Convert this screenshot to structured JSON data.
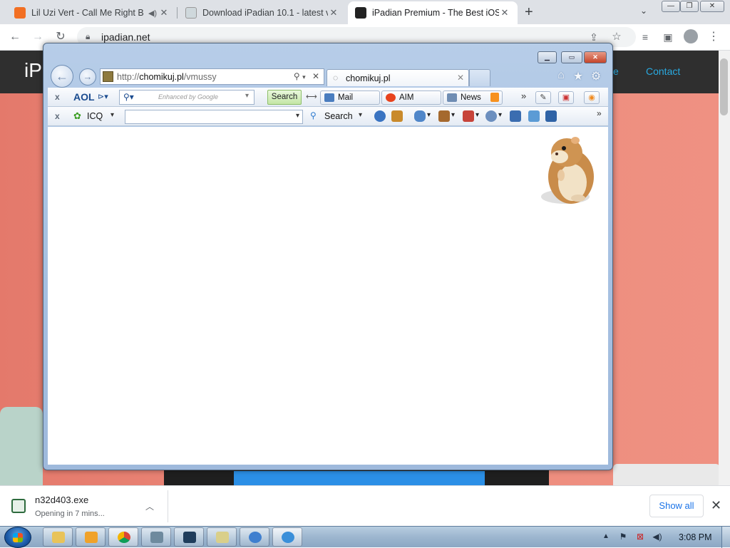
{
  "chrome": {
    "tabs": [
      {
        "title": "Lil Uzi Vert - Call Me Right B",
        "favicon": "soundcloud-icon",
        "muted_icon": "speaker-icon",
        "active": false
      },
      {
        "title": "Download iPadian 10.1 - latest ve",
        "favicon": "site-icon",
        "active": false
      },
      {
        "title": "iPadian Premium - The Best iOS s",
        "favicon": "ipadian-icon",
        "active": true
      }
    ],
    "new_tab_label": "+",
    "tab_search_label": "⌄",
    "url": "ipadian.net"
  },
  "webpage": {
    "logo_text": "iP",
    "nav_partial": "e",
    "nav_contact": "Contact",
    "colors": {
      "header": "#2f2f2f",
      "nav_link": "#29a9e0",
      "hero": "#e57466"
    }
  },
  "ie": {
    "address_prefix": "http://",
    "address_host": "chomikuj.pl",
    "address_path": "/vmussy",
    "tab_title": "chomikuj.pl",
    "aol_toolbar": {
      "brand": "AOL",
      "search_placeholder": "Enhanced by Google",
      "search_button": "Search",
      "mail_label": "Mail",
      "aim_label": "AIM",
      "news_label": "News",
      "more_label": "»"
    },
    "icq_toolbar": {
      "brand": "ICQ",
      "search_button": "Search",
      "more_label": "»"
    }
  },
  "download": {
    "filename": "n32d403.exe",
    "status": "Opening in 7 mins...",
    "show_all_label": "Show all"
  },
  "taskbar": {
    "clock": "3:08 PM"
  }
}
